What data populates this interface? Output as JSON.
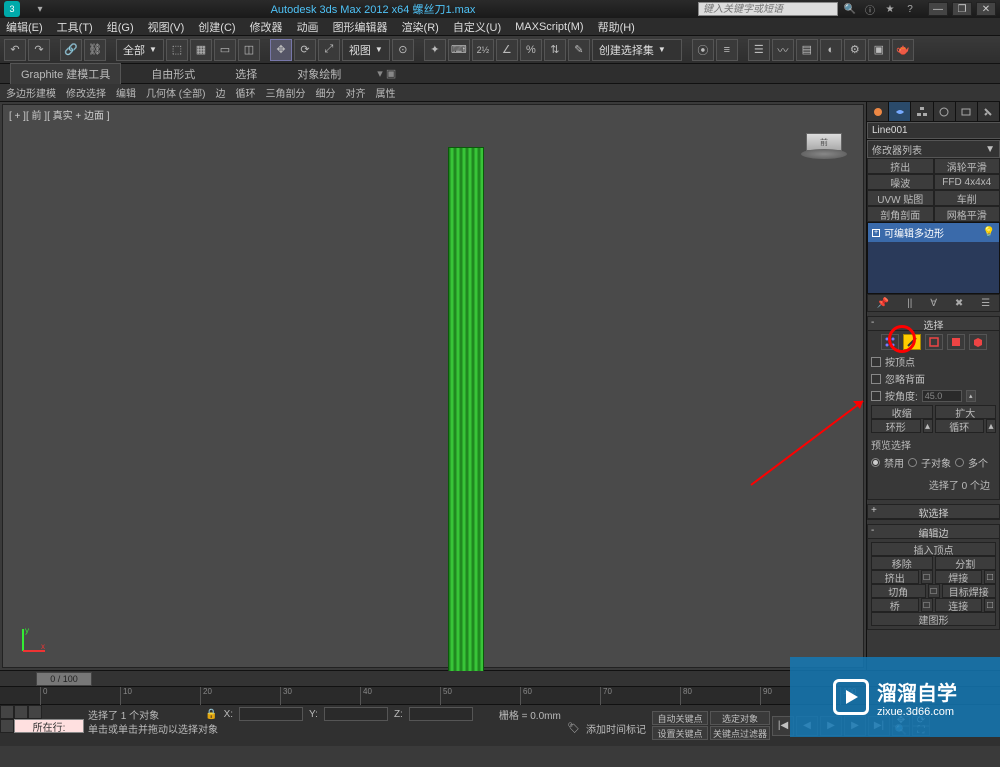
{
  "title_bar": {
    "app_title": "Autodesk 3ds Max 2012 x64    螺丝刀1.max",
    "search_placeholder": "键入关键字或短语"
  },
  "menu": {
    "items": [
      "编辑(E)",
      "工具(T)",
      "组(G)",
      "视图(V)",
      "创建(C)",
      "修改器",
      "动画",
      "图形编辑器",
      "渲染(R)",
      "自定义(U)",
      "MAXScript(M)",
      "帮助(H)"
    ]
  },
  "toolbar": {
    "selection_filter": "全部",
    "view_label": "视图",
    "named_set": "创建选择集"
  },
  "ribbon": {
    "tabs": [
      "Graphite 建模工具",
      "自由形式",
      "选择",
      "对象绘制"
    ],
    "strip": [
      "多边形建模",
      "修改选择",
      "编辑",
      "几何体 (全部)",
      "边",
      "循环",
      "三角剖分",
      "细分",
      "对齐",
      "属性"
    ]
  },
  "viewport": {
    "label": "[ + ][ 前 ][ 真实 + 边面 ]",
    "cube_face": "前"
  },
  "cmd_panel": {
    "object_name": "Line001",
    "modifier_list": "修改器列表",
    "mod_buttons": [
      "挤出",
      "涡轮平滑",
      "噪波",
      "FFD 4x4x4",
      "UVW 贴图",
      "车削",
      "剖角剖面",
      "网格平滑"
    ],
    "stack_item": "可编辑多边形",
    "rollouts": {
      "selection": {
        "title": "选择",
        "by_vertex": "按顶点",
        "ignore_back": "忽略背面",
        "by_angle": "按角度:",
        "angle_val": "45.0",
        "shrink": "收缩",
        "grow": "扩大",
        "ring": "环形",
        "loop": "循环",
        "preview_label": "预览选择",
        "radio_off": "禁用",
        "radio_sub": "子对象",
        "radio_multi": "多个",
        "status": "选择了 0 个边"
      },
      "soft_sel": "软选择",
      "edit_edge": {
        "title": "编辑边",
        "insert_vertex": "插入顶点",
        "remove": "移除",
        "split": "分割",
        "extrude": "挤出",
        "weld": "焊接",
        "chamfer": "切角",
        "target_weld": "目标焊接",
        "bridge": "桥",
        "connect": "连接",
        "create_shape": "建图形"
      }
    }
  },
  "timeline": {
    "slider": "0 / 100"
  },
  "status": {
    "current_label": "所在行:",
    "sel_info": "选择了 1 个对象",
    "prompt": "单击或单击并拖动以选择对象",
    "add_marker": "添加时间标记",
    "x": "X:",
    "y": "Y:",
    "z": "Z:",
    "grid": "栅格 = 0.0mm",
    "auto_key": "自动关键点",
    "set_key": "设置关键点",
    "sel_target": "选定对象",
    "key_filter": "关键点过滤器"
  },
  "watermark": {
    "brand": "溜溜自学",
    "url": "zixue.3d66.com"
  }
}
